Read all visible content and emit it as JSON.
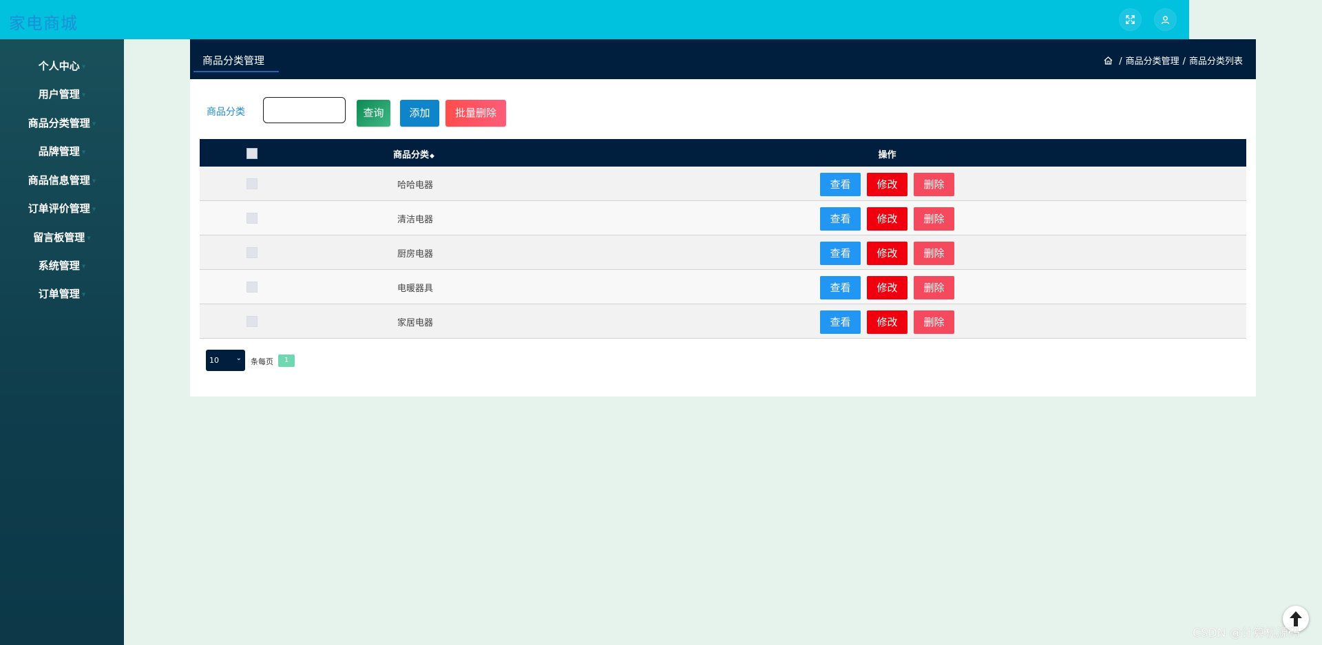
{
  "app": {
    "title": "家电商城"
  },
  "header_icons": [
    {
      "name": "fullscreen-icon",
      "glyph": "⤢"
    },
    {
      "name": "user-icon",
      "glyph": "👤"
    }
  ],
  "sidebar": {
    "items": [
      {
        "label": "个人中心"
      },
      {
        "label": "用户管理"
      },
      {
        "label": "商品分类管理"
      },
      {
        "label": "品牌管理"
      },
      {
        "label": "商品信息管理"
      },
      {
        "label": "订单评价管理"
      },
      {
        "label": "留言板管理"
      },
      {
        "label": "系统管理"
      },
      {
        "label": "订单管理"
      }
    ]
  },
  "panel": {
    "title": "商品分类管理",
    "breadcrumb": [
      "商品分类管理",
      "商品分类列表"
    ]
  },
  "search": {
    "label": "商品分类",
    "value": "",
    "query_button": "查询",
    "add_button": "添加",
    "batch_delete_button": "批量删除"
  },
  "table": {
    "headers": {
      "name": "商品分类",
      "operation": "操作"
    },
    "rows": [
      {
        "name": "哈哈电器"
      },
      {
        "name": "清洁电器"
      },
      {
        "name": "厨房电器"
      },
      {
        "name": "电暖器具"
      },
      {
        "name": "家居电器"
      }
    ],
    "row_buttons": {
      "view": "查看",
      "edit": "修改",
      "delete": "删除"
    }
  },
  "pagination": {
    "page_size": "10",
    "per_page_label": "条每页",
    "current_page": "1"
  },
  "watermark": "CSDN @计算机源码",
  "colors": {
    "topbar": "#00c1de",
    "panel_header": "#001f3f",
    "view": "#2196f3",
    "edit": "#f0000e",
    "delete": "#f5495d"
  }
}
